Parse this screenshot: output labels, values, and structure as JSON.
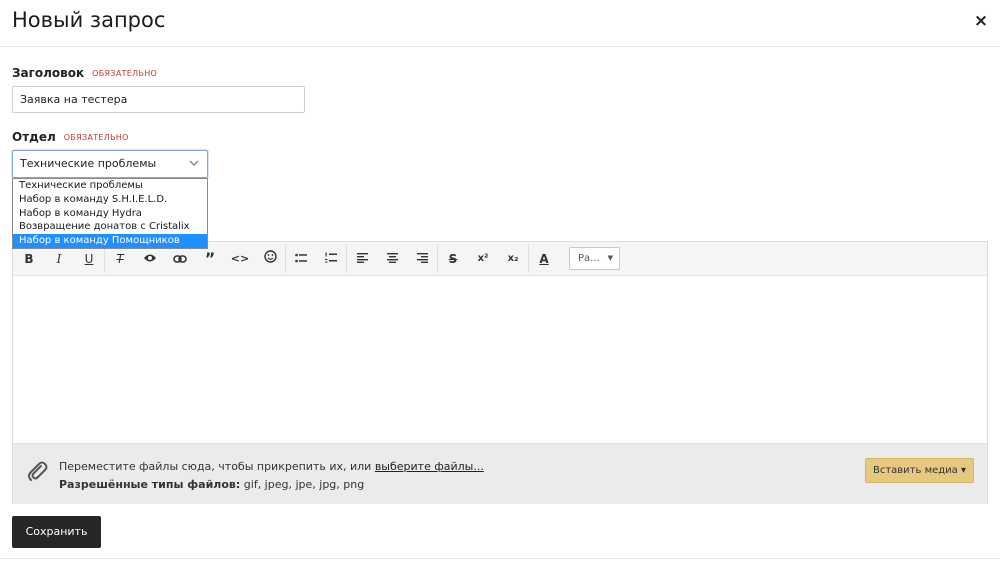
{
  "modal": {
    "title": "Новый запрос",
    "close_icon": "×"
  },
  "title_field": {
    "label": "Заголовок",
    "required": "ОБЯЗАТЕЛЬНО",
    "value": "Заявка на тестера"
  },
  "department_field": {
    "label": "Отдел",
    "required": "ОБЯЗАТЕЛЬНО",
    "selected": "Технические проблемы",
    "options": [
      "Технические проблемы",
      "Набор в команду S.H.I.E.L.D.",
      "Набор в команду Hydra",
      "Возвращение донатов с Cristalix",
      "Набор в команду Помощников"
    ],
    "highlighted_index": 4,
    "highlight_color": "#1e90ff"
  },
  "toolbar": {
    "bold": "B",
    "italic": "I",
    "underline": "U",
    "clear_format": "T",
    "spoiler_icon": "eye-icon",
    "link_icon": "link-icon",
    "quote": "”",
    "code": "<>",
    "smilie_icon": "smile-icon",
    "strike": "S",
    "superscript": "x²",
    "subscript": "x₂",
    "text_color": "A",
    "size_select": "Ра..."
  },
  "attachments": {
    "drop_text": "Переместите файлы сюда, чтобы прикрепить их, или ",
    "choose_link": "выберите файлы...",
    "types_label": "Разрешённые типы файлов:",
    "types_value": " gif, jpeg, jpe, jpg, png",
    "insert_media": "Вставить медиа ▾",
    "accent_color": "#e6c97f"
  },
  "save_button": "Сохранить"
}
